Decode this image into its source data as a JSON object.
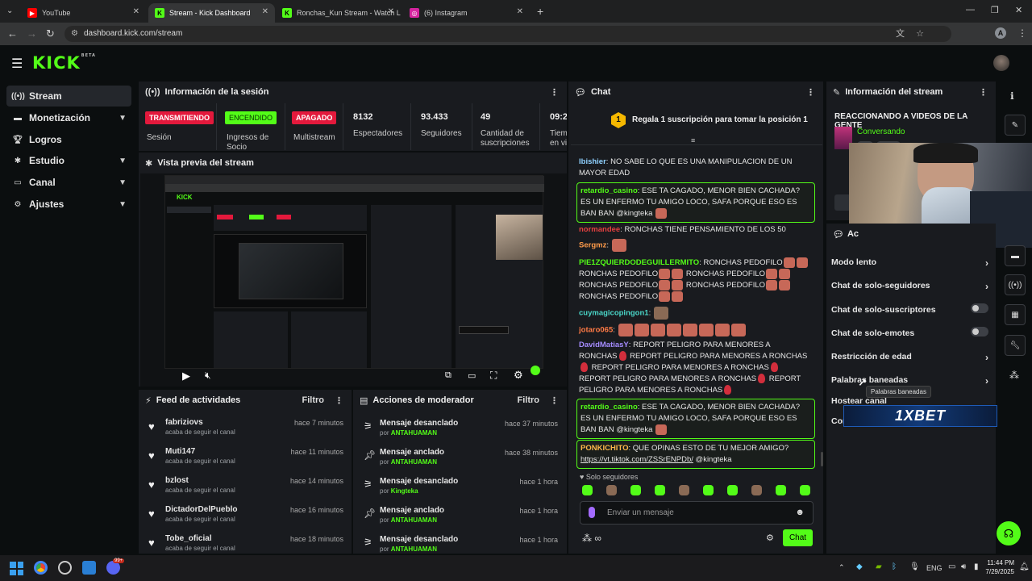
{
  "browser": {
    "tabs": [
      {
        "title": "YouTube"
      },
      {
        "title": "Stream - Kick Dashboard"
      },
      {
        "title": "Ronchas_Kun Stream - Watch L"
      },
      {
        "title": "(6) Instagram"
      }
    ],
    "url": "dashboard.kick.com/stream",
    "avatar_letter": "A"
  },
  "app": {
    "logo": "KICK",
    "logo_sup": "BETA"
  },
  "sidebar": {
    "items": [
      {
        "label": "Stream"
      },
      {
        "label": "Monetización"
      },
      {
        "label": "Logros"
      },
      {
        "label": "Estudio"
      },
      {
        "label": "Canal"
      },
      {
        "label": "Ajustes"
      }
    ]
  },
  "session": {
    "title": "Información de la sesión",
    "stats": [
      {
        "badge": "TRANSMITIENDO",
        "label": "Sesión"
      },
      {
        "badge": "ENCENDIDO",
        "label": "Ingresos de Socio"
      },
      {
        "badge": "APAGADO",
        "label": "Multistream"
      },
      {
        "value": "8132",
        "label": "Espectadores"
      },
      {
        "value": "93.433",
        "label": "Seguidores"
      },
      {
        "value": "49",
        "label": "Cantidad de suscripciones"
      },
      {
        "value": "09:2",
        "label": "Tiem en vi"
      }
    ]
  },
  "preview": {
    "title": "Vista previa del stream"
  },
  "feed": {
    "title": "Feed de actividades",
    "filter": "Filtro",
    "items": [
      {
        "name": "fabriziovs",
        "sub": "acaba de seguir el canal",
        "time": "hace 7 minutos"
      },
      {
        "name": "Muti147",
        "sub": "acaba de seguir el canal",
        "time": "hace 11 minutos"
      },
      {
        "name": "bzlost",
        "sub": "acaba de seguir el canal",
        "time": "hace 14 minutos"
      },
      {
        "name": "DictadorDelPueblo",
        "sub": "acaba de seguir el canal",
        "time": "hace 16 minutos"
      },
      {
        "name": "Tobe_oficial",
        "sub": "acaba de seguir el canal",
        "time": "hace 18 minutos"
      }
    ]
  },
  "mod": {
    "title": "Acciones de moderador",
    "filter": "Filtro",
    "items": [
      {
        "action": "Mensaje desanclado",
        "by": "por",
        "user": "ANTAHUAMAN",
        "time": "hace 37 minutos"
      },
      {
        "action": "Mensaje anclado",
        "by": "por",
        "user": "ANTAHUAMAN",
        "time": "hace 38 minutos"
      },
      {
        "action": "Mensaje desanclado",
        "by": "por",
        "user": "Kingteka",
        "time": "hace 1 hora"
      },
      {
        "action": "Mensaje anclado",
        "by": "por",
        "user": "ANTAHUAMAN",
        "time": "hace 1 hora"
      },
      {
        "action": "Mensaje desanclado",
        "by": "por",
        "user": "ANTAHUAMAN",
        "time": "hace 1 hora"
      }
    ]
  },
  "chat": {
    "title": "Chat",
    "sub_rank": "1",
    "sub_banner": "Regala 1 suscripción para tomar la posición 1",
    "messages": [
      {
        "user": "Ibishier",
        "color": "#8fd1ff",
        "text": "NO SABE LO QUE ES UNA MANIPULACION DE UN MAYOR EDAD"
      },
      {
        "user": "retardio_casino",
        "color": "#53fc18",
        "text": "ESE TA CAGADO, MENOR BIEN CACHADA? ES UN ENFERMO TU AMIGO LOCO, SAFA PORQUE ESO ES BAN BAN @kingteka"
      },
      {
        "user": "normandee",
        "color": "#e64040",
        "text": "RONCHAS TIENE PENSAMIENTO DE LOS 50"
      },
      {
        "user": "Sergmz",
        "color": "#ff9b4a",
        "text": ""
      },
      {
        "user": "PIE1ZQUIERDODEGUILLERMITO",
        "color": "#53fc18",
        "text": "RONCHAS PEDOFILO",
        "t2": "RONCHAS PEDOFILO",
        "t3": "RONCHAS PEDOFILO",
        "t4": "RONCHAS PEDOFILO",
        "t5": "RONCHAS PEDOFILO",
        "t6": "RONCHAS PEDOFILO"
      },
      {
        "user": "cuymagicopingon1",
        "color": "#4ad6c8",
        "text": ""
      },
      {
        "user": "jotaro065",
        "color": "#ff7a45",
        "text": ""
      },
      {
        "user": "DavidMatiasY",
        "color": "#a58cff",
        "text": "REPORT PELIGRO PARA MENORES A RONCHAS",
        "t2": "REPORT PELIGRO PARA MENORES A RONCHAS",
        "t3": "REPORT PELIGRO PARA MENORES A RONCHAS",
        "t4": "REPORT PELIGRO PARA MENORES A RONCHAS",
        "t5": "REPORT PELIGRO PARA MENORES A RONCHAS"
      },
      {
        "user": "retardio_casino",
        "color": "#53fc18",
        "text": "ESE TA CAGADO, MENOR BIEN CACHADA? ES UN ENFERMO TU AMIGO LOCO, SAFA PORQUE ESO ES BAN BAN @kingteka"
      },
      {
        "user": "PONKICHITO",
        "color": "#ffb84a",
        "text": "QUE OPINAS ESTO DE TU MEJOR AMIGO?",
        "link": "https://vt.tiktok.com/ZSSrENPDb/",
        "mention": "@kingteka"
      }
    ],
    "mode": "Solo seguidores",
    "input_placeholder": "Enviar un mensaje",
    "send_label": "Chat"
  },
  "streaminfo": {
    "title": "Información del stream",
    "stream_title": "REACCIONANDO A VIDEOS DE LA GENTE",
    "category": "Conversando"
  },
  "actions": {
    "title": "Ac",
    "items": [
      {
        "label": "Modo lento",
        "type": "arrow"
      },
      {
        "label": "Chat de solo-seguidores",
        "type": "arrow"
      },
      {
        "label": "Chat de solo-suscriptores",
        "type": "toggle"
      },
      {
        "label": "Chat de solo-emotes",
        "type": "toggle"
      },
      {
        "label": "Restricción de edad",
        "type": "arrow"
      },
      {
        "label": "Palabras baneadas",
        "type": "arrow"
      },
      {
        "label": "Hostear canal",
        "type": "none"
      },
      {
        "label": "Cor",
        "type": "none"
      }
    ],
    "tooltip": "Palabras baneadas",
    "sponsor": "1XBET"
  },
  "taskbar": {
    "lang": "ENG",
    "time": "11:44 PM",
    "date": "7/29/2025",
    "badge": "99+"
  },
  "colors": {
    "kick_green": "#53fc18",
    "live_red": "#e3193c",
    "panel": "#191b1f",
    "bg": "#0b0e0f"
  }
}
